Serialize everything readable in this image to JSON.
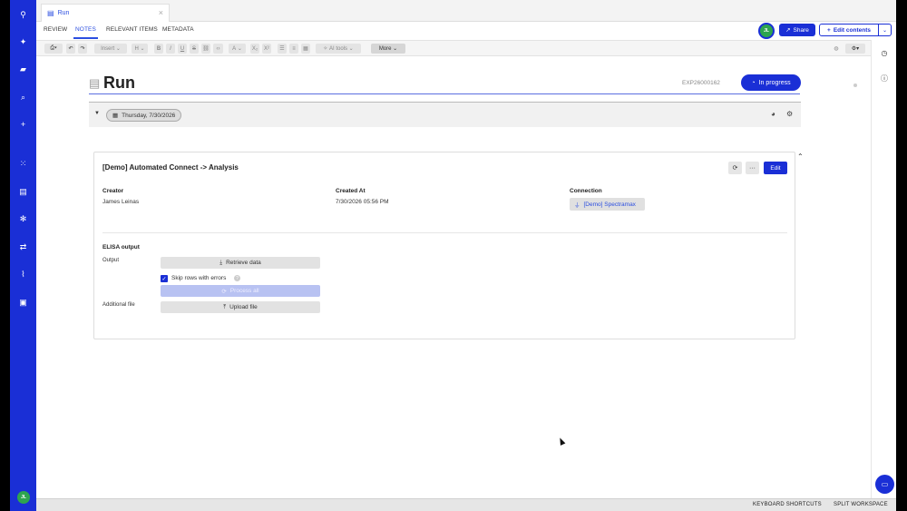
{
  "nav": {
    "avatar_initials": "JL"
  },
  "tab": {
    "title": "Run",
    "close": "×"
  },
  "sections": {
    "review": "REVIEW",
    "notes": "NOTES",
    "relevant_items": "RELEVANT ITEMS",
    "metadata": "METADATA"
  },
  "header": {
    "user_initials": "JL",
    "share_label": "Share",
    "edit_contents_label": "Edit contents"
  },
  "toolbar": {
    "insert_label": "Insert",
    "heading_label": "H",
    "bold": "B",
    "italic": "I",
    "underline": "U",
    "strike": "S",
    "font_label": "A",
    "subscript": "X₂",
    "superscript": "X²",
    "ai_tools_label": "AI tools",
    "more_label": "More"
  },
  "document": {
    "title": "Run",
    "experiment_id": "EXP26000162",
    "status_label": "In progress",
    "date_label": "Thursday, 7/30/2026"
  },
  "card": {
    "title": "[Demo] Automated Connect -> Analysis",
    "edit_label": "Edit",
    "more_label": "···",
    "creator_label": "Creator",
    "creator_value": "James Leinas",
    "created_at_label": "Created At",
    "created_at_value": "7/30/2026 05:56 PM",
    "connection_label": "Connection",
    "connection_value": "[Demo] Spectramax",
    "elisa_label": "ELISA output",
    "output_label": "Output",
    "retrieve_label": "Retrieve data",
    "skip_rows_label": "Skip rows with errors",
    "process_all_label": "Process all",
    "additional_file_label": "Additional file",
    "upload_label": "Upload file"
  },
  "footer": {
    "keyboard_shortcuts": "KEYBOARD SHORTCUTS",
    "split_workspace": "SPLIT WORKSPACE"
  },
  "colors": {
    "brand": "#1a2fd6",
    "accent_link": "#2b4ee0",
    "avatar_green": "#2ea44f"
  }
}
